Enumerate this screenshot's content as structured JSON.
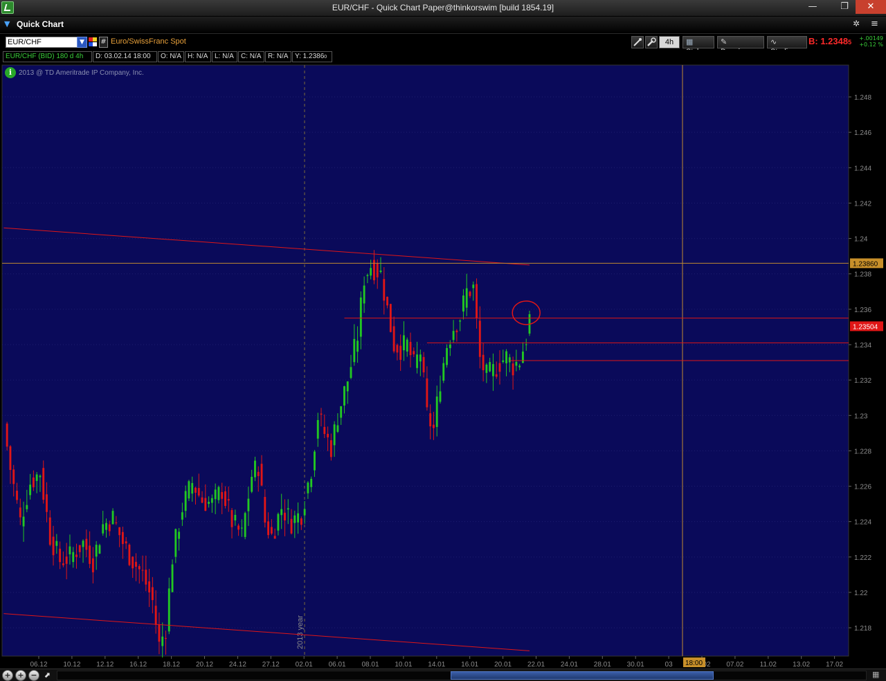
{
  "window": {
    "title": "EUR/CHF - Quick Chart Paper@thinkorswim [build 1854.19]",
    "minimize": "—",
    "maximize": "❐",
    "close": "✕"
  },
  "panel": {
    "name": "Quick Chart",
    "collapse_glyph": "▼",
    "pin_glyph": "✲",
    "menu_glyph": "≡"
  },
  "toolbar": {
    "symbol": "EUR/CHF",
    "hash": "#",
    "description": "Euro/SwissFranc Spot",
    "aggregation": "4h",
    "style_label": "Style",
    "drawings_label": "Drawings",
    "studies_label": "Studies",
    "bid": "B: 1.2348",
    "bid_sub": "5",
    "change_abs": "+.00149",
    "change_pct": "+0.12 %"
  },
  "infobar": {
    "symbol_period": "EUR/CHF (BID) 180 d 4h",
    "date": "D: 03.02.14 18:00",
    "open": "O: N/A",
    "high": "H: N/A",
    "low": "L: N/A",
    "close": "C: N/A",
    "range": "R: N/A",
    "y": "Y: 1.2386",
    "y_sub": "0"
  },
  "chart": {
    "copyright": "2013 @ TD Ameritrade IP Company, Inc.",
    "info_glyph": "i",
    "year_marker": "2013 year",
    "cursor_time": "18:00",
    "cursor_price_label": "1.2386",
    "cursor_price_sub": "0",
    "last_price_label": "1.2350",
    "last_price_sub": "4",
    "colors": {
      "background": "#0a0a5a",
      "up_candle": "#22c822",
      "down_candle": "#e01616",
      "trendline": "#e01616",
      "cursor": "#c08a30",
      "axis_text": "#8c8c8c"
    }
  },
  "chart_data": {
    "type": "candlestick",
    "title": "EUR/CHF (BID) 180 d 4h",
    "xlabel": "",
    "ylabel": "",
    "ylim": [
      1.2164,
      1.2498
    ],
    "y_ticks": [
      "1.248",
      "1.246",
      "1.244",
      "1.242",
      "1.24",
      "1.238",
      "1.236",
      "1.234",
      "1.232",
      "1.23",
      "1.228",
      "1.226",
      "1.224",
      "1.222",
      "1.22",
      "1.218"
    ],
    "x_ticks": [
      "06.12",
      "10.12",
      "12.12",
      "16.12",
      "18.12",
      "20.12",
      "24.12",
      "27.12",
      "02.01",
      "06.01",
      "08.01",
      "10.01",
      "14.01",
      "16.01",
      "20.01",
      "22.01",
      "24.01",
      "28.01",
      "30.01",
      "03",
      "05.02",
      "07.02",
      "11.02",
      "13.02",
      "17.02"
    ],
    "grid": true,
    "price_path": [
      [
        0,
        1.2295
      ],
      [
        2,
        1.227
      ],
      [
        5,
        1.224
      ],
      [
        8,
        1.2262
      ],
      [
        11,
        1.2268
      ],
      [
        14,
        1.2232
      ],
      [
        17,
        1.2218
      ],
      [
        20,
        1.222
      ],
      [
        24,
        1.2228
      ],
      [
        27,
        1.2218
      ],
      [
        30,
        1.2238
      ],
      [
        33,
        1.2242
      ],
      [
        36,
        1.2228
      ],
      [
        39,
        1.2218
      ],
      [
        42,
        1.221
      ],
      [
        45,
        1.2195
      ],
      [
        47,
        1.217
      ],
      [
        49,
        1.218
      ],
      [
        51,
        1.222
      ],
      [
        54,
        1.2248
      ],
      [
        57,
        1.2262
      ],
      [
        60,
        1.2252
      ],
      [
        63,
        1.225
      ],
      [
        66,
        1.2258
      ],
      [
        69,
        1.224
      ],
      [
        72,
        1.2232
      ],
      [
        75,
        1.2266
      ],
      [
        77,
        1.2272
      ],
      [
        79,
        1.224
      ],
      [
        81,
        1.2232
      ],
      [
        84,
        1.2248
      ],
      [
        87,
        1.224
      ],
      [
        90,
        1.2245
      ],
      [
        93,
        1.227
      ],
      [
        95,
        1.23
      ],
      [
        97,
        1.229
      ],
      [
        99,
        1.2282
      ],
      [
        101,
        1.23
      ],
      [
        104,
        1.232
      ],
      [
        107,
        1.2345
      ],
      [
        109,
        1.2378
      ],
      [
        111,
        1.2385
      ],
      [
        114,
        1.238
      ],
      [
        116,
        1.236
      ],
      [
        118,
        1.234
      ],
      [
        120,
        1.2338
      ],
      [
        122,
        1.234
      ],
      [
        124,
        1.2328
      ],
      [
        126,
        1.2336
      ],
      [
        128,
        1.23
      ],
      [
        130,
        1.2292
      ],
      [
        132,
        1.232
      ],
      [
        134,
        1.234
      ],
      [
        136,
        1.235
      ],
      [
        138,
        1.2356
      ],
      [
        140,
        1.237
      ],
      [
        142,
        1.2372
      ],
      [
        144,
        1.2332
      ],
      [
        146,
        1.2322
      ],
      [
        148,
        1.2325
      ],
      [
        150,
        1.233
      ],
      [
        152,
        1.2333
      ],
      [
        154,
        1.2328
      ],
      [
        156,
        1.2331
      ],
      [
        158,
        1.2344
      ],
      [
        159,
        1.2355
      ]
    ],
    "annotations": [
      {
        "kind": "trendline",
        "from": [
          0,
          1.2406
        ],
        "to": [
          159,
          1.2385
        ]
      },
      {
        "kind": "trendline",
        "from": [
          0,
          1.2188
        ],
        "to": [
          159,
          1.2167
        ]
      },
      {
        "kind": "horizontal",
        "from": [
          103,
          1.2355
        ],
        "to": [
          255,
          1.2355
        ]
      },
      {
        "kind": "horizontal",
        "from": [
          128,
          1.2341
        ],
        "to": [
          255,
          1.2341
        ]
      },
      {
        "kind": "horizontal",
        "from": [
          153,
          1.2331
        ],
        "to": [
          255,
          1.2331
        ]
      },
      {
        "kind": "circle",
        "at": [
          158,
          1.2358
        ]
      }
    ],
    "cursor": {
      "price": 1.2386,
      "time": "18:00"
    },
    "last_price": 1.23504
  }
}
